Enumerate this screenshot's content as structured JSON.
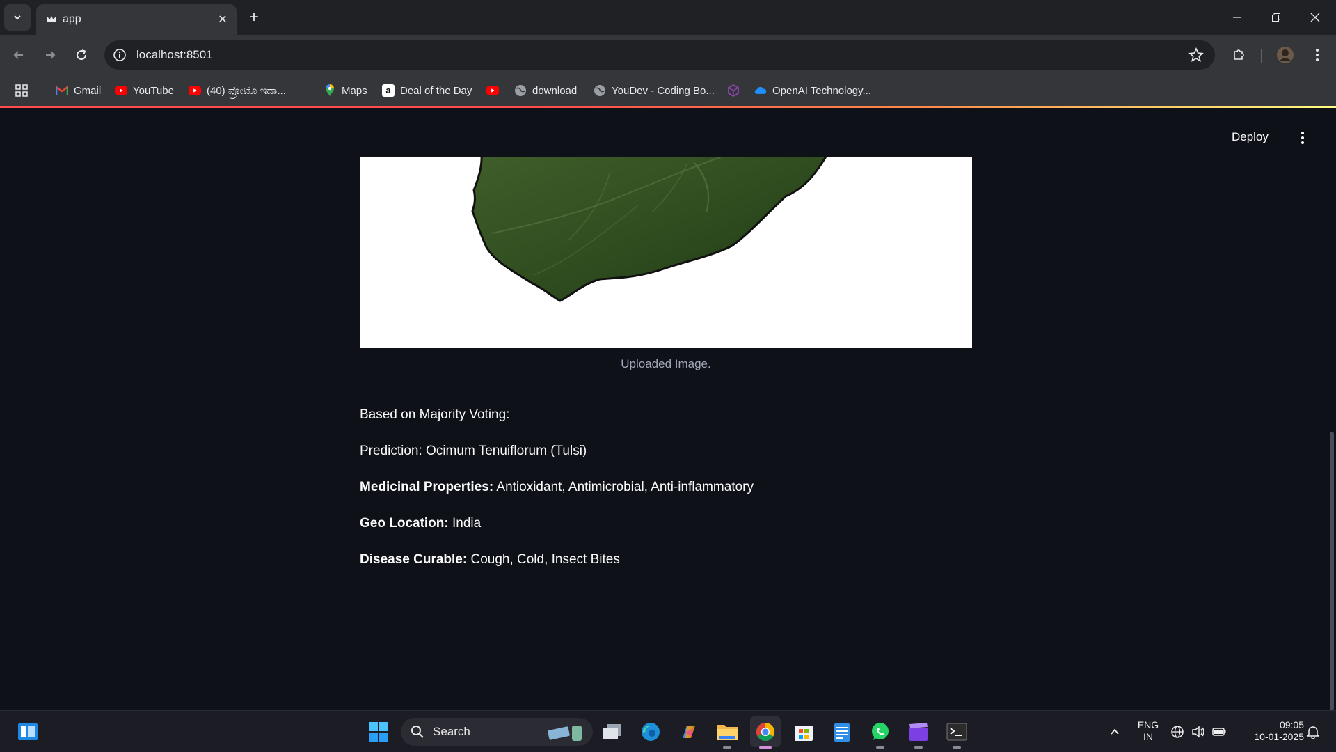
{
  "browser": {
    "tab_title": "app",
    "url": "localhost:8501",
    "bookmarks": [
      {
        "label": "Gmail",
        "icon": "gmail-icon"
      },
      {
        "label": "YouTube",
        "icon": "youtube-icon"
      },
      {
        "label": "(40) ಪ್ರೋಟೊ ಇದಾ...",
        "icon": "youtube-icon"
      },
      {
        "label": "Maps",
        "icon": "maps-icon"
      },
      {
        "label": "Deal of the Day",
        "icon": "amazon-icon"
      },
      {
        "label": "",
        "icon": "youtube-icon"
      },
      {
        "label": "download",
        "icon": "globe-icon"
      },
      {
        "label": "YouDev - Coding Bo...",
        "icon": "globe-icon"
      },
      {
        "label": "",
        "icon": "cube-icon"
      },
      {
        "label": "OpenAI Technology...",
        "icon": "cloud-icon"
      }
    ]
  },
  "app": {
    "deploy_label": "Deploy",
    "image_caption": "Uploaded Image.",
    "majority_text": "Based on Majority Voting:",
    "prediction_text": "Prediction: Ocimum Tenuiflorum (Tulsi)",
    "medicinal_label": "Medicinal Properties:",
    "medicinal_value": " Antioxidant, Antimicrobial, Anti-inflammatory",
    "geo_label": "Geo Location:",
    "geo_value": " India",
    "disease_label": "Disease Curable:",
    "disease_value": " Cough, Cold, Insect Bites"
  },
  "taskbar": {
    "search_label": "Search",
    "lang_line1": "ENG",
    "lang_line2": "IN",
    "time": "09:05",
    "date": "10-01-2025"
  },
  "colors": {
    "app_bg": "#0e1117",
    "accent": "#ff4b4b",
    "caption": "#a3a8b8"
  }
}
